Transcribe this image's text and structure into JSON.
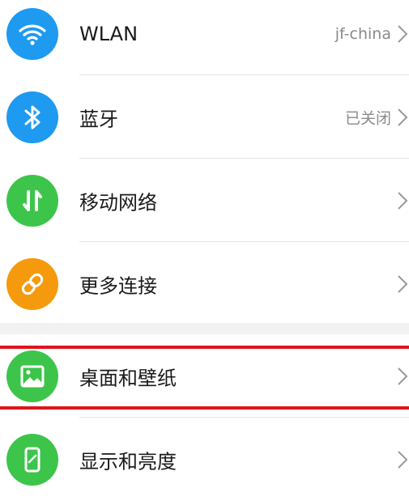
{
  "settings": {
    "items": [
      {
        "label": "WLAN",
        "value": "jf-china",
        "icon": "wifi-icon",
        "color": "#1e9af0"
      },
      {
        "label": "蓝牙",
        "value": "已关闭",
        "icon": "bluetooth-icon",
        "color": "#1e9af0"
      },
      {
        "label": "移动网络",
        "value": "",
        "icon": "mobile-data-icon",
        "color": "#3cc54a"
      },
      {
        "label": "更多连接",
        "value": "",
        "icon": "link-icon",
        "color": "#f59a0c"
      },
      {
        "label": "桌面和壁纸",
        "value": "",
        "icon": "image-icon",
        "color": "#3cc54a"
      },
      {
        "label": "显示和亮度",
        "value": "",
        "icon": "display-icon",
        "color": "#3cc54a"
      }
    ],
    "highlighted_item": "桌面和壁纸",
    "highlight_color": "#e0141b"
  }
}
